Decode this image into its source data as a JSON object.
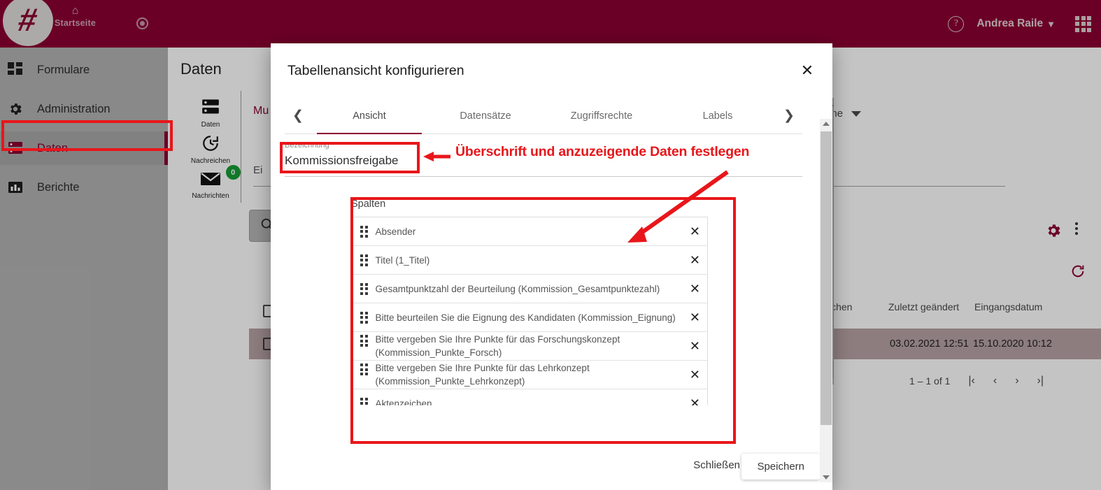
{
  "topbar": {
    "logo_alt": "hash-logo",
    "home_label": "Startseite",
    "record_icon": "record-icon",
    "help_icon": "help-icon",
    "user_name": "Andrea Raile",
    "chevron": "⌄",
    "apps_icon": "apps-grid-icon",
    "brand_color": "#8c0032"
  },
  "sidebar": {
    "items": [
      {
        "label": "Formulare",
        "icon": "forms-icon",
        "active": false
      },
      {
        "label": "Administration",
        "icon": "gear-icon",
        "active": false
      },
      {
        "label": "Daten",
        "icon": "database-icon",
        "active": true
      },
      {
        "label": "Berichte",
        "icon": "chart-bar-icon",
        "active": false
      }
    ]
  },
  "background": {
    "page_title": "Daten",
    "side_icons": [
      {
        "label": "Daten",
        "icon": "database-icon",
        "badge": null
      },
      {
        "label": "Nachreichen",
        "icon": "history-clock-icon",
        "badge": null
      },
      {
        "label": "Nachrichten",
        "icon": "envelope-icon",
        "badge": "0"
      }
    ],
    "muster_text": "Mu",
    "ei_label": "Ei",
    "bereiche_label": "sbereiche",
    "search_icon": "search-icon",
    "gear_icon": "gear-icon",
    "kebab_icon": "more-vertical-icon",
    "refresh_icon": "refresh-icon",
    "table": {
      "headers": [
        "ichen",
        "Zuletzt geändert",
        "Eingangsdatum"
      ],
      "rows": [
        {
          "zuletzt_geaendert": "03.02.2021 12:51",
          "eingangsdatum": "15.10.2020 10:12"
        }
      ]
    },
    "pagination": {
      "range": "1 – 1 of 1",
      "first": "|‹",
      "prev": "‹",
      "next": "›",
      "last": "›|"
    }
  },
  "modal": {
    "title": "Tabellenansicht konfigurieren",
    "close_icon": "close-icon",
    "tab_prev_icon": "chevron-left-icon",
    "tab_next_icon": "chevron-right-icon",
    "tabs": [
      {
        "label": "Ansicht",
        "active": true
      },
      {
        "label": "Datensätze",
        "active": false
      },
      {
        "label": "Zugriffsrechte",
        "active": false
      },
      {
        "label": "Labels",
        "active": false
      }
    ],
    "bezeichnung": {
      "label": "Bezeichnung *",
      "value": "Kommissionsfreigabe",
      "placeholder": "Bezeichnung"
    },
    "spalten": {
      "title": "Spalten",
      "remove_icon": "close-icon",
      "drag_icon": "drag-handle-icon",
      "items": [
        {
          "label": "Absender"
        },
        {
          "label": "Titel (1_Titel)"
        },
        {
          "label": "Gesamtpunktzahl der Beurteilung (Kommission_Gesamtpunktezahl)"
        },
        {
          "label": "Bitte beurteilen Sie die Eignung des Kandidaten (Kommission_Eignung)"
        },
        {
          "label": "Bitte vergeben Sie Ihre Punkte für das Forschungskonzept (Kommission_Punkte_Forsch)"
        },
        {
          "label": "Bitte vergeben Sie Ihre Punkte für das Lehrkonzept (Kommission_Punkte_Lehrkonzept)"
        },
        {
          "label": "Aktenzeichen"
        },
        {
          "label": ""
        }
      ]
    },
    "footer": {
      "close_label": "Schließen",
      "save_label": "Speichern"
    }
  },
  "annotation": {
    "color": "#e8161a",
    "text": "Überschrift und anzuzeigende Daten festlegen"
  }
}
